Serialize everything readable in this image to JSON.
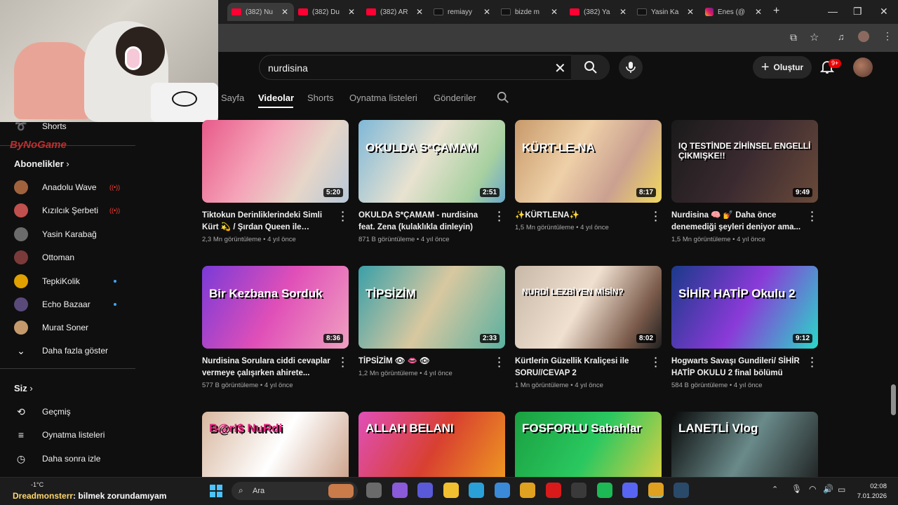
{
  "browser": {
    "tabs": [
      {
        "title": "(382) Nu",
        "kind": "youtube",
        "active": true
      },
      {
        "title": "(382) Du",
        "kind": "youtube"
      },
      {
        "title": "(382) AR",
        "kind": "youtube"
      },
      {
        "title": "remiayy",
        "kind": "tiktok"
      },
      {
        "title": "bizde m",
        "kind": "tiktok"
      },
      {
        "title": "(382) Ya",
        "kind": "youtube"
      },
      {
        "title": "Yasin Ka",
        "kind": "tiktok"
      },
      {
        "title": "Enes (@",
        "kind": "instagram"
      }
    ],
    "new_tab": "+"
  },
  "header": {
    "search_value": "nurdisina",
    "create_label": "Oluştur",
    "notification_count": "9+"
  },
  "channel_tabs": [
    {
      "label": "Sayfa"
    },
    {
      "label": "Videolar",
      "active": true
    },
    {
      "label": "Shorts"
    },
    {
      "label": "Oynatma listeleri"
    },
    {
      "label": "Gönderiler"
    }
  ],
  "sidebar": {
    "shorts": "Shorts",
    "subscriptions_heading": "Abonelikler",
    "subscriptions": [
      {
        "name": "Anadolu Wave",
        "status": "live"
      },
      {
        "name": "Kızılcık Şerbeti",
        "status": "live"
      },
      {
        "name": "Yasin Karabağ",
        "status": ""
      },
      {
        "name": "Ottoman",
        "status": ""
      },
      {
        "name": "TepkiKolik",
        "status": "new"
      },
      {
        "name": "Echo Bazaar",
        "status": "new"
      },
      {
        "name": "Murat Soner",
        "status": ""
      }
    ],
    "show_more": "Daha fazla göster",
    "you_heading": "Siz",
    "you_items": [
      "Geçmiş",
      "Oynatma listeleri",
      "Daha sonra izle"
    ]
  },
  "videos": [
    {
      "title": "Tiktokun Derinliklerindeki Simli Kürt 💫 / Şırdan Queen ile Dedikodu...",
      "views": "2,3 Mn görüntüleme",
      "age": "4 yıl önce",
      "duration": "5:20",
      "overlay": ""
    },
    {
      "title": "OKULDA S*ÇAMAM - nurdisina feat. Zena (kulaklıkla dinleyin)",
      "views": "871 B görüntüleme",
      "age": "4 yıl önce",
      "duration": "2:51",
      "overlay": "OKULDA S*ÇAMAM"
    },
    {
      "title": "✨KÜRTLENA✨",
      "views": "1,5 Mn görüntüleme",
      "age": "4 yıl önce",
      "duration": "8:17",
      "overlay": "KÜRT-LE-NA"
    },
    {
      "title": "Nurdisina 🧠 💅 Daha önce denemediği şeyleri deniyor ama...",
      "views": "1,5 Mn görüntüleme",
      "age": "4 yıl önce",
      "duration": "9:49",
      "overlay": "IQ TESTİNDE ZİHİNSEL ENGELLİ ÇIKMIŞKE!!"
    },
    {
      "title": "Nurdisina Sorulara ciddi cevaplar vermeye çalışırken ahirete...",
      "views": "577 B görüntüleme",
      "age": "4 yıl önce",
      "duration": "8:36",
      "overlay": "Bir Kezbana Sorduk"
    },
    {
      "title": "TİPSİZİM 👁 👄 👁",
      "views": "1,2 Mn görüntüleme",
      "age": "4 yıl önce",
      "duration": "2:33",
      "overlay": "TİPSİZİM"
    },
    {
      "title": "Kürtlerin Güzellik Kraliçesi ile SORU//CEVAP 2",
      "views": "1 Mn görüntüleme",
      "age": "4 yıl önce",
      "duration": "8:02",
      "overlay": "NURDİ LEZBİYEN MİSİN?"
    },
    {
      "title": "Hogwarts Savaşı Gundileri/ SİHİR HATİP OKULU 2 final bölümü",
      "views": "584 B görüntüleme",
      "age": "4 yıl önce",
      "duration": "9:12",
      "overlay": "SİHİR HATİP Okulu 2"
    },
    {
      "title": "",
      "views": "",
      "age": "",
      "duration": "",
      "overlay": "B@rI$ NuRdi"
    },
    {
      "title": "",
      "views": "",
      "age": "",
      "duration": "",
      "overlay": "ALLAH BELANI"
    },
    {
      "title": "",
      "views": "",
      "age": "",
      "duration": "",
      "overlay": "FOSFORLU Sabahlar"
    },
    {
      "title": "",
      "views": "",
      "age": "",
      "duration": "",
      "overlay": "LANETLİ Vlog"
    }
  ],
  "taskbar": {
    "search_placeholder": "Ara",
    "weather": "-1°C",
    "time": "02:08",
    "date": "7.01.2026"
  },
  "stream_overlay": {
    "chat_user": "Dreadmonsterr",
    "chat_message": ": bilmek zorundamıyam",
    "brand": "ByNoGame"
  },
  "colors": {
    "background": "#0f0f0f",
    "youtube_red": "#ff0033",
    "accent_blue": "#3ea6ff"
  }
}
